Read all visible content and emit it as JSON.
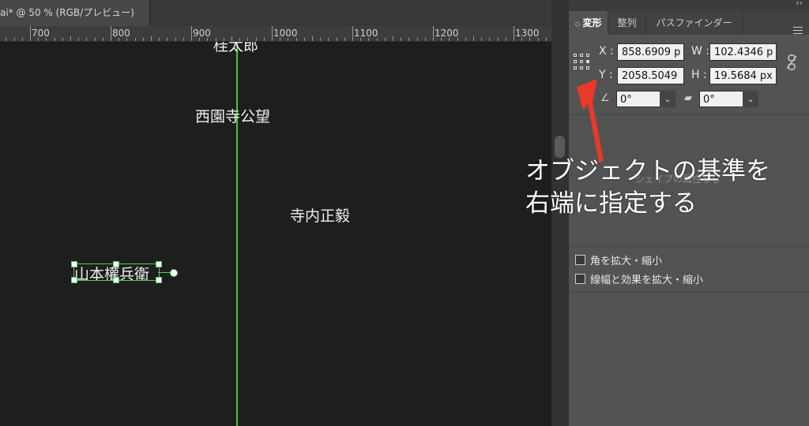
{
  "document": {
    "tab_title": "ai* @ 50 % (RGB/プレビュー)"
  },
  "ruler": {
    "labels": [
      "700",
      "800",
      "900",
      "1000",
      "1100",
      "1200",
      "1300"
    ]
  },
  "canvas": {
    "names": {
      "top": "桂太郎",
      "saionji": "西園寺公望",
      "terauchi": "寺内正毅",
      "yamamoto": "山本權兵衛"
    },
    "guide_color": "#3ec93e"
  },
  "panel": {
    "collapse": "››",
    "tabs": {
      "transform": "変形",
      "align": "整列",
      "pathfinder": "パスファインダー"
    },
    "x_label": "X :",
    "y_label": "Y :",
    "w_label": "W :",
    "h_label": "H :",
    "x_value": "858.6909 p",
    "y_value": "2058.5049",
    "w_value": "102.4346 p",
    "h_value": "19.5684 px",
    "rotate_value": "0°",
    "shear_value": "0°",
    "shape_props": "シェイプの属性なし",
    "checkbox_corners": "角を拡大・縮小",
    "checkbox_stroke": "線幅と効果を拡大・縮小"
  },
  "annotation": {
    "line1": "オブジェクトの基準を",
    "line2": "右端に指定する",
    "arrow_color": "#e8392b"
  }
}
